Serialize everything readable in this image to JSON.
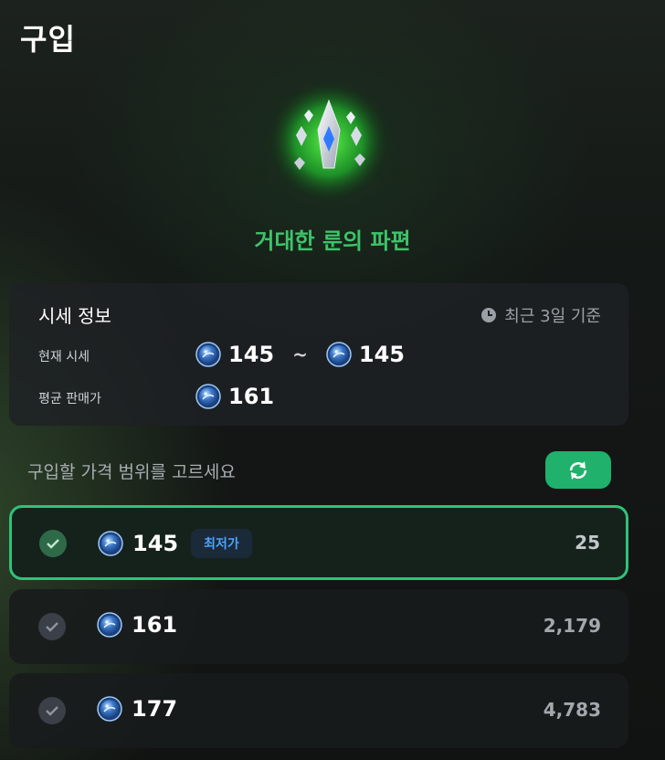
{
  "header": {
    "title": "구입"
  },
  "item": {
    "name": "거대한 룬의 파편",
    "icon": "rune-shard-icon",
    "name_color": "#3cc46a"
  },
  "market_info": {
    "title": "시세 정보",
    "basis_text": "최근 3일 기준",
    "current_label": "현재 시세",
    "current_min": "145",
    "current_range_sep": "~",
    "current_max": "145",
    "average_label": "평균 판매가",
    "average_value": "161",
    "currency_icon": "blue-coin-icon"
  },
  "price_range": {
    "prompt": "구입할 가격 범위를 고르세요",
    "refresh_icon": "refresh-icon",
    "accent_color": "#20b16c",
    "options": [
      {
        "price": "145",
        "badge": "최저가",
        "quantity": "25",
        "selected": true
      },
      {
        "price": "161",
        "badge": "",
        "quantity": "2,179",
        "selected": false
      },
      {
        "price": "177",
        "badge": "",
        "quantity": "4,783",
        "selected": false
      }
    ]
  }
}
